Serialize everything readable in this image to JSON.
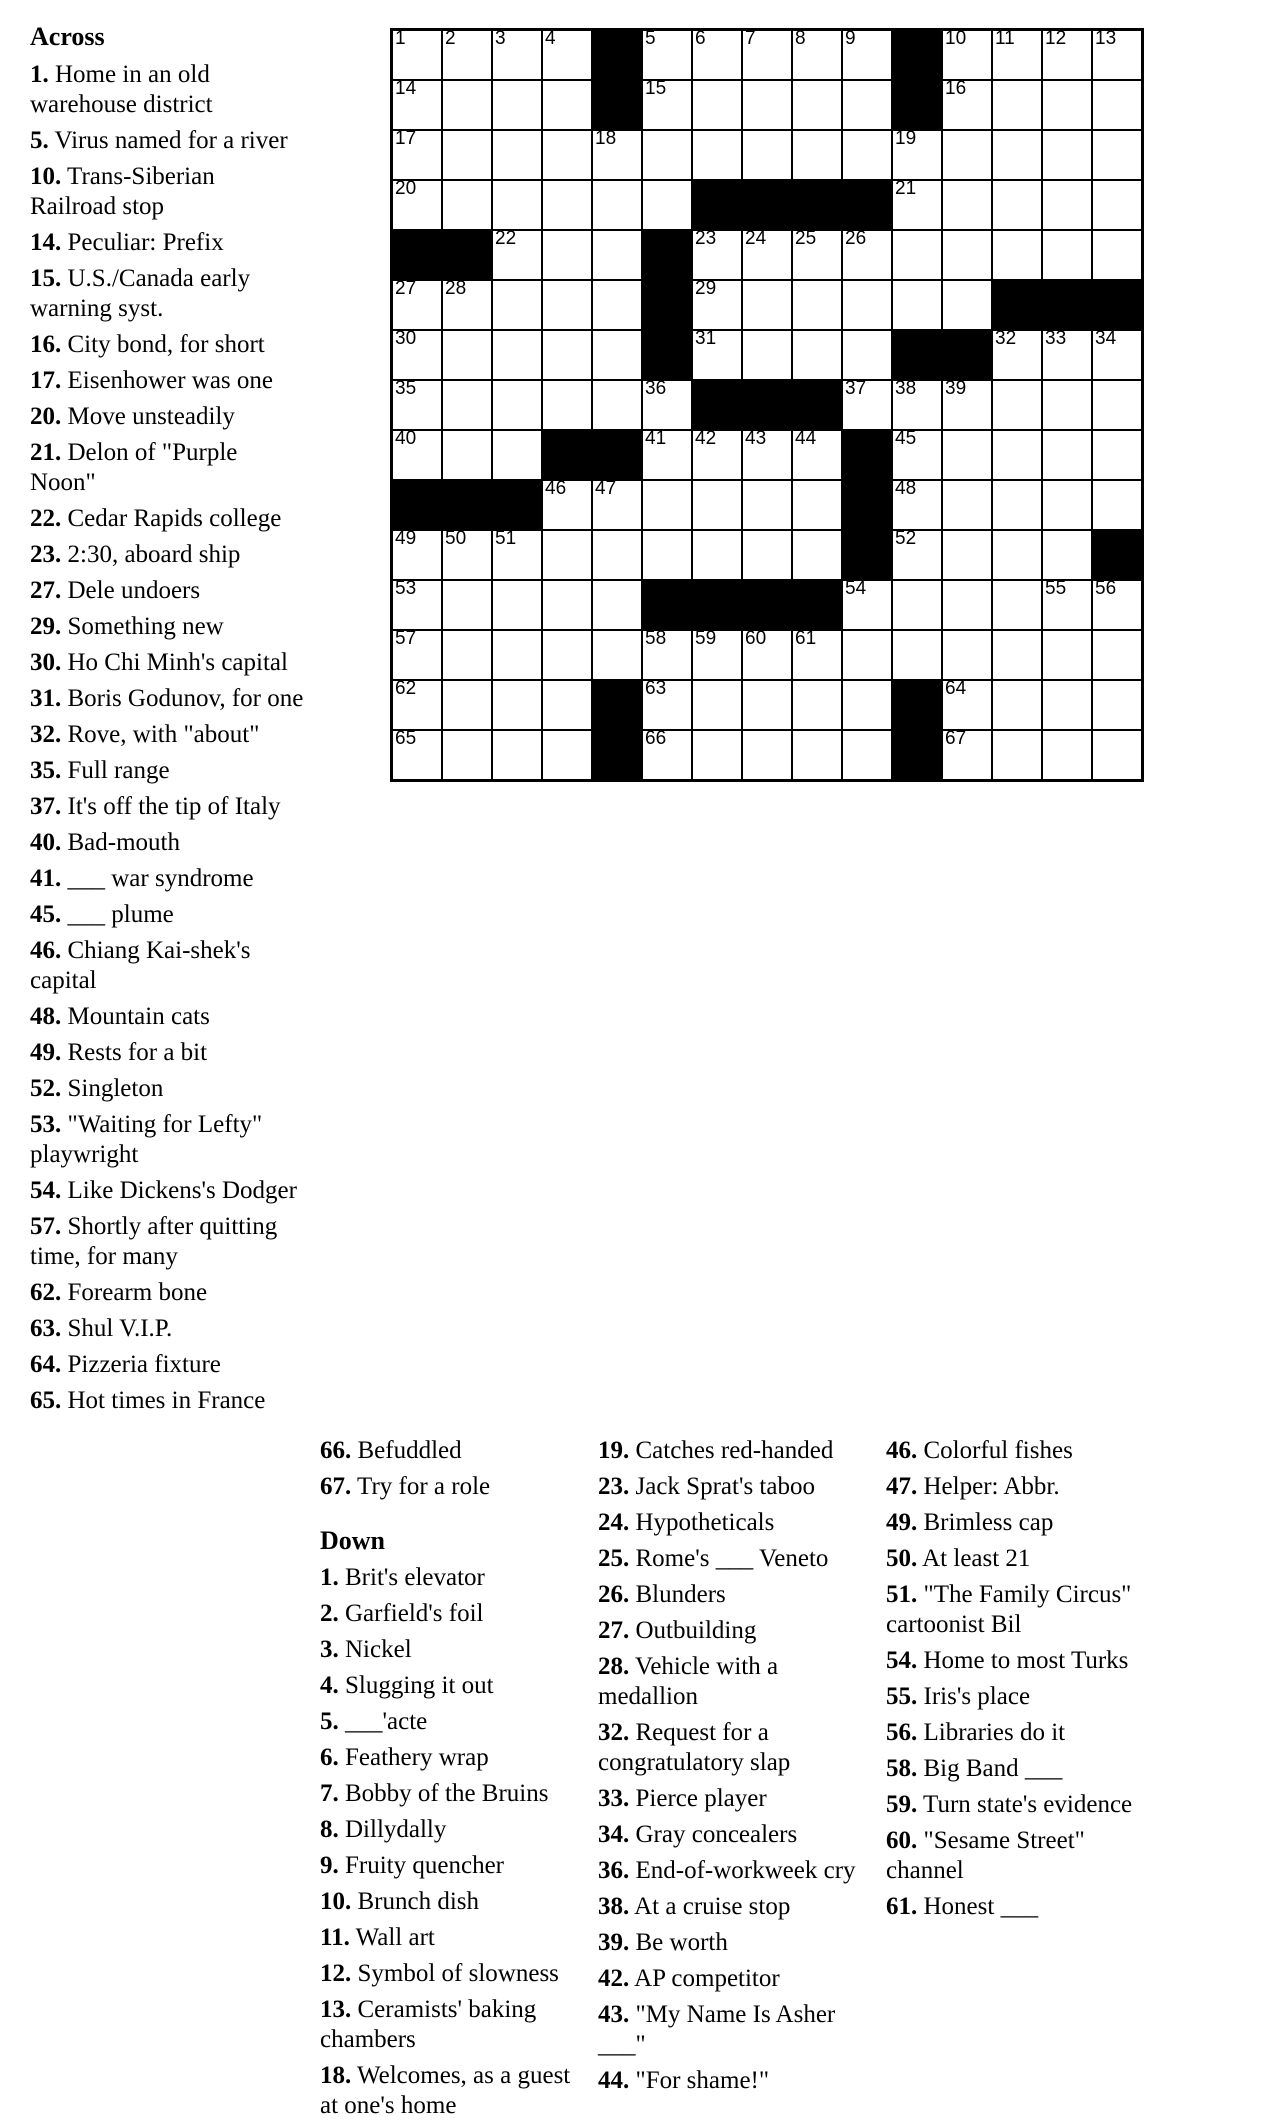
{
  "headings": {
    "across": "Across",
    "down": "Down"
  },
  "across_col1": [
    {
      "num": "1.",
      "text": "Home in an old warehouse district"
    },
    {
      "num": "5.",
      "text": "Virus named for a river"
    },
    {
      "num": "10.",
      "text": "Trans-Siberian Railroad stop"
    },
    {
      "num": "14.",
      "text": "Peculiar: Prefix"
    },
    {
      "num": "15.",
      "text": "U.S./Canada early warning syst."
    },
    {
      "num": "16.",
      "text": "City bond, for short"
    },
    {
      "num": "17.",
      "text": "Eisenhower was one"
    },
    {
      "num": "20.",
      "text": "Move unsteadily"
    },
    {
      "num": "21.",
      "text": "Delon of \"Purple Noon\""
    },
    {
      "num": "22.",
      "text": "Cedar Rapids college"
    },
    {
      "num": "23.",
      "text": "2:30, aboard ship"
    },
    {
      "num": "27.",
      "text": "Dele undoers"
    },
    {
      "num": "29.",
      "text": "Something new"
    },
    {
      "num": "30.",
      "text": "Ho Chi Minh's capital"
    },
    {
      "num": "31.",
      "text": "Boris Godunov, for one"
    },
    {
      "num": "32.",
      "text": "Rove, with \"about\""
    },
    {
      "num": "35.",
      "text": "Full range"
    },
    {
      "num": "37.",
      "text": "It's off the tip of Italy"
    },
    {
      "num": "40.",
      "text": "Bad-mouth"
    },
    {
      "num": "41.",
      "text": "___ war syndrome"
    },
    {
      "num": "45.",
      "text": "___ plume"
    },
    {
      "num": "46.",
      "text": "Chiang Kai-shek's capital"
    },
    {
      "num": "48.",
      "text": "Mountain cats"
    },
    {
      "num": "49.",
      "text": "Rests for a bit"
    },
    {
      "num": "52.",
      "text": "Singleton"
    },
    {
      "num": "53.",
      "text": "\"Waiting for Lefty\" playwright"
    },
    {
      "num": "54.",
      "text": "Like Dickens's Dodger"
    },
    {
      "num": "57.",
      "text": "Shortly after quitting time, for many"
    },
    {
      "num": "62.",
      "text": "Forearm bone"
    },
    {
      "num": "63.",
      "text": "Shul V.I.P."
    },
    {
      "num": "64.",
      "text": "Pizzeria fixture"
    },
    {
      "num": "65.",
      "text": "Hot times in France"
    }
  ],
  "across_col2": [
    {
      "num": "66.",
      "text": "Befuddled"
    },
    {
      "num": "67.",
      "text": "Try for a role"
    }
  ],
  "down_col2": [
    {
      "num": "1.",
      "text": "Brit's elevator"
    },
    {
      "num": "2.",
      "text": "Garfield's foil"
    },
    {
      "num": "3.",
      "text": "Nickel"
    },
    {
      "num": "4.",
      "text": "Slugging it out"
    },
    {
      "num": "5.",
      "text": "___'acte"
    },
    {
      "num": "6.",
      "text": "Feathery wrap"
    },
    {
      "num": "7.",
      "text": "Bobby of the Bruins"
    },
    {
      "num": "8.",
      "text": "Dillydally"
    },
    {
      "num": "9.",
      "text": "Fruity quencher"
    },
    {
      "num": "10.",
      "text": "Brunch dish"
    },
    {
      "num": "11.",
      "text": "Wall art"
    },
    {
      "num": "12.",
      "text": "Symbol of slowness"
    },
    {
      "num": "13.",
      "text": "Ceramists' baking chambers"
    },
    {
      "num": "18.",
      "text": "Welcomes, as a guest at one's home"
    }
  ],
  "down_col3": [
    {
      "num": "19.",
      "text": "Catches red-handed"
    },
    {
      "num": "23.",
      "text": "Jack Sprat's taboo"
    },
    {
      "num": "24.",
      "text": "Hypotheticals"
    },
    {
      "num": "25.",
      "text": "Rome's ___ Veneto"
    },
    {
      "num": "26.",
      "text": "Blunders"
    },
    {
      "num": "27.",
      "text": "Outbuilding"
    },
    {
      "num": "28.",
      "text": "Vehicle with a medallion"
    },
    {
      "num": "32.",
      "text": "Request for a congratulatory slap"
    },
    {
      "num": "33.",
      "text": "Pierce player"
    },
    {
      "num": "34.",
      "text": "Gray concealers"
    },
    {
      "num": "36.",
      "text": "End-of-workweek cry"
    },
    {
      "num": "38.",
      "text": "At a cruise stop"
    },
    {
      "num": "39.",
      "text": "Be worth"
    },
    {
      "num": "42.",
      "text": "AP competitor"
    },
    {
      "num": "43.",
      "text": "\"My Name Is Asher ___\""
    },
    {
      "num": "44.",
      "text": "\"For shame!\""
    }
  ],
  "down_col4": [
    {
      "num": "46.",
      "text": "Colorful fishes"
    },
    {
      "num": "47.",
      "text": "Helper: Abbr."
    },
    {
      "num": "49.",
      "text": "Brimless cap"
    },
    {
      "num": "50.",
      "text": "At least 21"
    },
    {
      "num": "51.",
      "text": "\"The Family Circus\" cartoonist Bil"
    },
    {
      "num": "54.",
      "text": "Home to most Turks"
    },
    {
      "num": "55.",
      "text": "Iris's place"
    },
    {
      "num": "56.",
      "text": "Libraries do it"
    },
    {
      "num": "58.",
      "text": "Big Band ___"
    },
    {
      "num": "59.",
      "text": "Turn state's evidence"
    },
    {
      "num": "60.",
      "text": "\"Sesame Street\" channel"
    },
    {
      "num": "61.",
      "text": "Honest ___"
    }
  ],
  "grid": {
    "rows": 15,
    "cols": 15,
    "cells": [
      [
        {
          "n": "1"
        },
        {
          "n": "2"
        },
        {
          "n": "3"
        },
        {
          "n": "4"
        },
        {
          "b": true
        },
        {
          "n": "5"
        },
        {
          "n": "6"
        },
        {
          "n": "7"
        },
        {
          "n": "8"
        },
        {
          "n": "9"
        },
        {
          "b": true
        },
        {
          "n": "10"
        },
        {
          "n": "11"
        },
        {
          "n": "12"
        },
        {
          "n": "13"
        }
      ],
      [
        {
          "n": "14"
        },
        {},
        {},
        {},
        {
          "b": true
        },
        {
          "n": "15"
        },
        {},
        {},
        {},
        {},
        {
          "b": true
        },
        {
          "n": "16"
        },
        {},
        {},
        {}
      ],
      [
        {
          "n": "17"
        },
        {},
        {},
        {},
        {
          "n": "18"
        },
        {},
        {},
        {},
        {},
        {},
        {
          "n": "19"
        },
        {},
        {},
        {},
        {}
      ],
      [
        {
          "n": "20"
        },
        {},
        {},
        {},
        {},
        {},
        {
          "b": true
        },
        {
          "b": true
        },
        {
          "b": true
        },
        {
          "b": true
        },
        {
          "n": "21"
        },
        {},
        {},
        {},
        {}
      ],
      [
        {
          "b": true
        },
        {
          "b": true
        },
        {
          "n": "22"
        },
        {},
        {},
        {
          "b": true
        },
        {
          "n": "23"
        },
        {
          "n": "24"
        },
        {
          "n": "25"
        },
        {
          "n": "26"
        },
        {},
        {},
        {},
        {},
        {}
      ],
      [
        {
          "n": "27"
        },
        {
          "n": "28"
        },
        {},
        {},
        {},
        {
          "b": true
        },
        {
          "n": "29"
        },
        {},
        {},
        {},
        {},
        {},
        {
          "b": true
        },
        {
          "b": true
        },
        {
          "b": true
        }
      ],
      [
        {
          "n": "30"
        },
        {},
        {},
        {},
        {},
        {
          "b": true
        },
        {
          "n": "31"
        },
        {},
        {},
        {},
        {
          "b": true
        },
        {
          "b": true
        },
        {
          "n": "32"
        },
        {
          "n": "33"
        },
        {
          "n": "34"
        }
      ],
      [
        {
          "n": "35"
        },
        {},
        {},
        {},
        {},
        {
          "n": "36"
        },
        {
          "b": true
        },
        {
          "b": true
        },
        {
          "b": true
        },
        {
          "n": "37"
        },
        {
          "n": "38"
        },
        {
          "n": "39"
        },
        {},
        {},
        {}
      ],
      [
        {
          "n": "40"
        },
        {},
        {},
        {
          "b": true
        },
        {
          "b": true
        },
        {
          "n": "41"
        },
        {
          "n": "42"
        },
        {
          "n": "43"
        },
        {
          "n": "44"
        },
        {
          "b": true
        },
        {
          "n": "45"
        },
        {},
        {},
        {},
        {}
      ],
      [
        {
          "b": true
        },
        {
          "b": true
        },
        {
          "b": true
        },
        {
          "n": "46"
        },
        {
          "n": "47"
        },
        {},
        {},
        {},
        {},
        {
          "b": true
        },
        {
          "n": "48"
        },
        {},
        {},
        {},
        {}
      ],
      [
        {
          "n": "49"
        },
        {
          "n": "50"
        },
        {
          "n": "51"
        },
        {},
        {},
        {},
        {},
        {},
        {},
        {
          "b": true
        },
        {
          "n": "52"
        },
        {},
        {},
        {},
        {
          "b": true
        }
      ],
      [
        {
          "n": "53"
        },
        {},
        {},
        {},
        {},
        {
          "b": true
        },
        {
          "b": true
        },
        {
          "b": true
        },
        {
          "b": true
        },
        {
          "n": "54"
        },
        {},
        {},
        {},
        {
          "n": "55"
        },
        {
          "n": "56"
        }
      ],
      [
        {
          "n": "57"
        },
        {},
        {},
        {},
        {},
        {
          "n": "58"
        },
        {
          "n": "59"
        },
        {
          "n": "60"
        },
        {
          "n": "61"
        },
        {},
        {},
        {},
        {},
        {},
        {}
      ],
      [
        {
          "n": "62"
        },
        {},
        {},
        {},
        {
          "b": true
        },
        {
          "n": "63"
        },
        {},
        {},
        {},
        {},
        {
          "b": true
        },
        {
          "n": "64"
        },
        {},
        {},
        {}
      ],
      [
        {
          "n": "65"
        },
        {},
        {},
        {},
        {
          "b": true
        },
        {
          "n": "66"
        },
        {},
        {},
        {},
        {},
        {
          "b": true
        },
        {
          "n": "67"
        },
        {},
        {},
        {}
      ]
    ]
  }
}
